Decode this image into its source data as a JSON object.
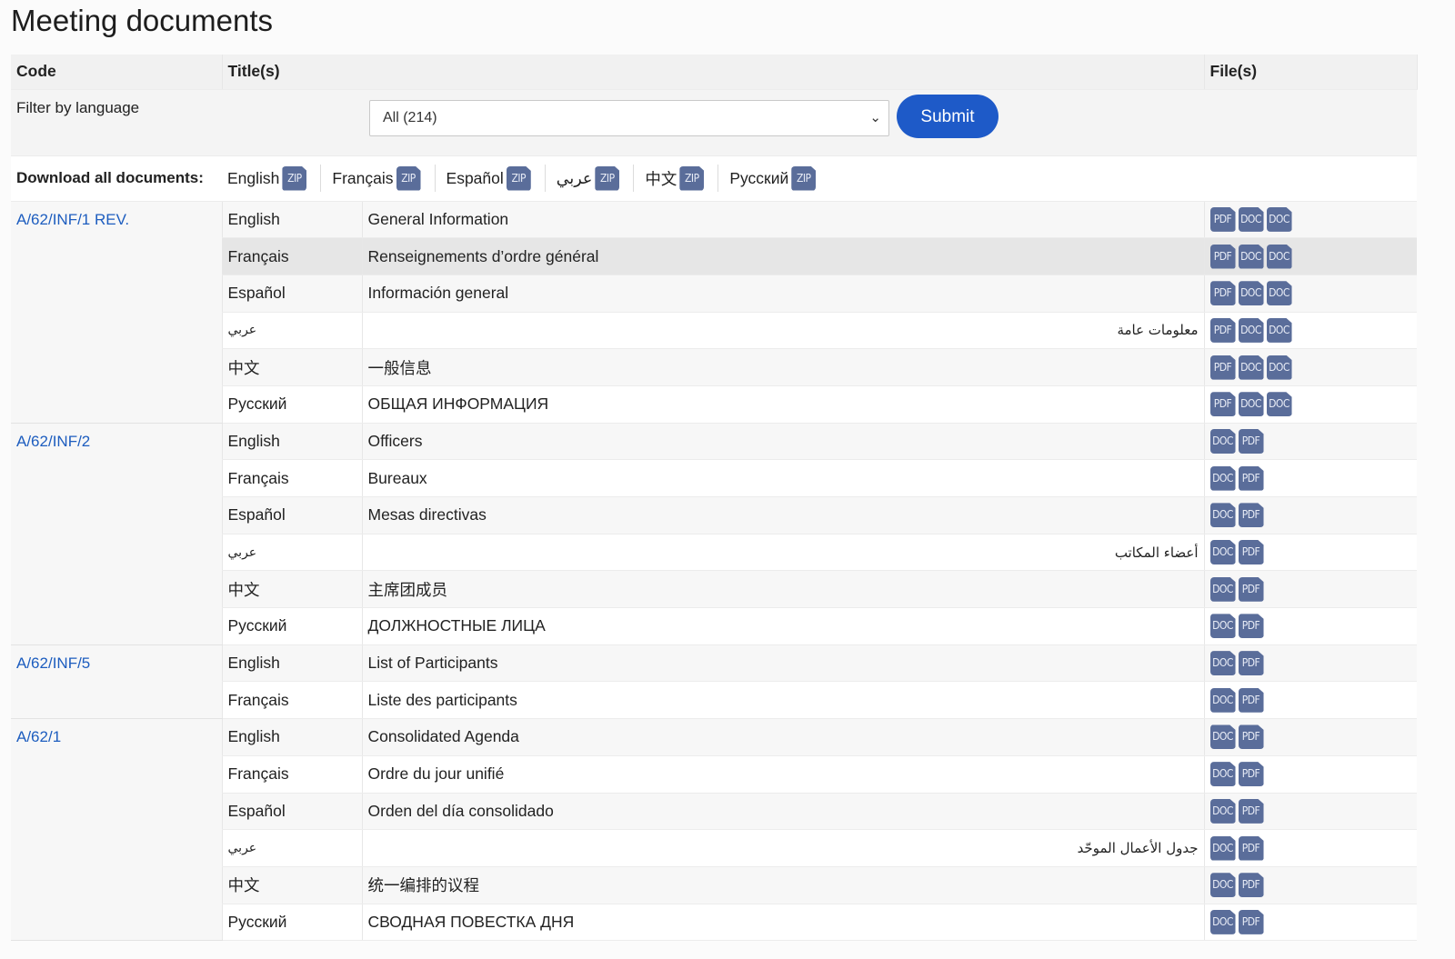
{
  "page": {
    "title": "Meeting documents"
  },
  "table": {
    "headers": {
      "code": "Code",
      "titles": "Title(s)",
      "files": "File(s)"
    },
    "filter": {
      "label": "Filter by language",
      "selected": "All (214)",
      "submit_label": "Submit"
    },
    "download_all": {
      "label": "Download all documents:",
      "items": [
        {
          "name": "English",
          "icon": "ZIP"
        },
        {
          "name": "Français",
          "icon": "ZIP"
        },
        {
          "name": "Español",
          "icon": "ZIP"
        },
        {
          "name": "عربي",
          "icon": "ZIP"
        },
        {
          "name": "中文",
          "icon": "ZIP"
        },
        {
          "name": "Русский",
          "icon": "ZIP"
        }
      ]
    },
    "groups": [
      {
        "code": "A/62/INF/1 REV.",
        "rows": [
          {
            "lang": "English",
            "title": "General Information",
            "files": [
              "PDF",
              "DOC",
              "DOC"
            ]
          },
          {
            "lang": "Français",
            "title": "Renseignements d’ordre général",
            "files": [
              "PDF",
              "DOC",
              "DOC"
            ],
            "highlight": true
          },
          {
            "lang": "Español",
            "title": "Información general",
            "files": [
              "PDF",
              "DOC",
              "DOC"
            ]
          },
          {
            "lang": "عربي",
            "title": "معلومات عامة",
            "files": [
              "PDF",
              "DOC",
              "DOC"
            ],
            "rtl": true
          },
          {
            "lang": "中文",
            "title": "一般信息",
            "files": [
              "PDF",
              "DOC",
              "DOC"
            ]
          },
          {
            "lang": "Русский",
            "title": "ОБЩАЯ ИНФОРМАЦИЯ",
            "files": [
              "PDF",
              "DOC",
              "DOC"
            ]
          }
        ]
      },
      {
        "code": "A/62/INF/2",
        "rows": [
          {
            "lang": "English",
            "title": "Officers",
            "files": [
              "DOC",
              "PDF"
            ]
          },
          {
            "lang": "Français",
            "title": "Bureaux",
            "files": [
              "DOC",
              "PDF"
            ]
          },
          {
            "lang": "Español",
            "title": "Mesas directivas",
            "files": [
              "DOC",
              "PDF"
            ]
          },
          {
            "lang": "عربي",
            "title": "أعضاء المكاتب",
            "files": [
              "DOC",
              "PDF"
            ],
            "rtl": true
          },
          {
            "lang": "中文",
            "title": "主席团成员",
            "files": [
              "DOC",
              "PDF"
            ]
          },
          {
            "lang": "Русский",
            "title": "ДОЛЖНОСТНЫЕ ЛИЦА",
            "files": [
              "DOC",
              "PDF"
            ]
          }
        ]
      },
      {
        "code": "A/62/INF/5",
        "rows": [
          {
            "lang": "English",
            "title": "List of Participants",
            "files": [
              "DOC",
              "PDF"
            ]
          },
          {
            "lang": "Français",
            "title": "Liste des participants",
            "files": [
              "DOC",
              "PDF"
            ]
          }
        ]
      },
      {
        "code": "A/62/1",
        "rows": [
          {
            "lang": "English",
            "title": "Consolidated Agenda",
            "files": [
              "DOC",
              "PDF"
            ]
          },
          {
            "lang": "Français",
            "title": "Ordre du jour unifié",
            "files": [
              "DOC",
              "PDF"
            ]
          },
          {
            "lang": "Español",
            "title": "Orden del día consolidado",
            "files": [
              "DOC",
              "PDF"
            ]
          },
          {
            "lang": "عربي",
            "title": "جدول الأعمال الموحّد",
            "files": [
              "DOC",
              "PDF"
            ],
            "rtl": true
          },
          {
            "lang": "中文",
            "title": "统一编排的议程",
            "files": [
              "DOC",
              "PDF"
            ]
          },
          {
            "lang": "Русский",
            "title": "СВОДНАЯ ПОВЕСТКА ДНЯ",
            "files": [
              "DOC",
              "PDF"
            ]
          }
        ]
      }
    ]
  }
}
